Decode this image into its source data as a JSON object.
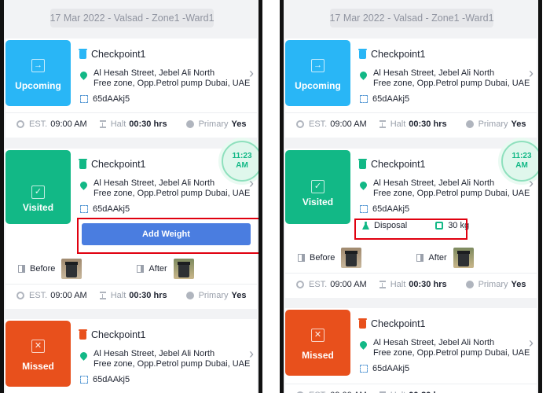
{
  "date_bar": "17 Mar 2022 - Valsad - Zone1 -Ward1",
  "checkpoint": {
    "name": "Checkpoint1",
    "address_line1": "Al Hesah Street, Jebel Ali North",
    "address_line2": "Free zone,  Opp.Petrol pump Dubai, UAE",
    "code": "65dAAkj5"
  },
  "info": {
    "est_label": "EST.",
    "est_value": "09:00 AM",
    "halt_label": "Halt",
    "halt_value": "00:30 hrs",
    "primary_label": "Primary",
    "primary_value": "Yes"
  },
  "status": {
    "upcoming": "Upcoming",
    "visited": "Visited",
    "missed": "Missed"
  },
  "visited_time": {
    "line1": "11:23",
    "line2": "AM"
  },
  "add_weight_label": "Add Weight",
  "before_label": "Before",
  "after_label": "After",
  "disposal": {
    "label": "Disposal",
    "weight": "30 kg"
  },
  "colors": {
    "upcoming": "#29b6f6",
    "visited": "#12b886",
    "missed": "#e8501c",
    "add_weight": "#4a7de0",
    "highlight": "#e0000f"
  },
  "icons": {
    "upcoming": "arrow-right-icon",
    "visited": "check-icon",
    "missed": "close-icon",
    "bin": "trash-bin-icon",
    "pin": "location-pin-icon",
    "code": "qr-code-icon",
    "est": "clock-icon",
    "halt": "hourglass-icon",
    "primary": "info-icon"
  }
}
